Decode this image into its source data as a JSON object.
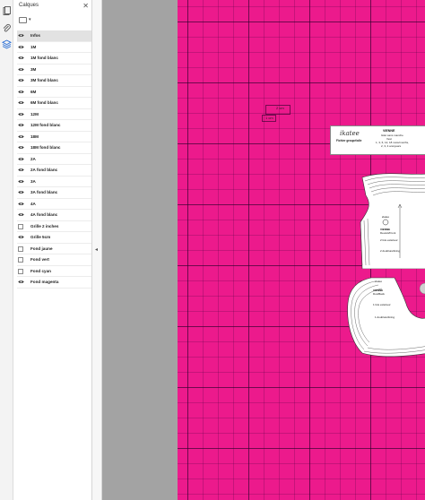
{
  "panel": {
    "title": "Calques",
    "close_label": "✕"
  },
  "layers": [
    {
      "label": "Infos",
      "visible": true,
      "selected": true
    },
    {
      "label": "1M",
      "visible": true
    },
    {
      "label": "1M fond blanc",
      "visible": true
    },
    {
      "label": "3M",
      "visible": true
    },
    {
      "label": "3M fond blanc",
      "visible": true
    },
    {
      "label": "6M",
      "visible": true
    },
    {
      "label": "6M fond blanc",
      "visible": true
    },
    {
      "label": "12M",
      "visible": true
    },
    {
      "label": "12M fond blanc",
      "visible": true
    },
    {
      "label": "18M",
      "visible": true
    },
    {
      "label": "18M fond blanc",
      "visible": true
    },
    {
      "label": "2A",
      "visible": true
    },
    {
      "label": "2A fond blanc",
      "visible": true
    },
    {
      "label": "3A",
      "visible": true
    },
    {
      "label": "3A fond blanc",
      "visible": true
    },
    {
      "label": "4A",
      "visible": true
    },
    {
      "label": "4A fond blanc",
      "visible": true
    },
    {
      "label": "Grille 2 inches",
      "visible": false
    },
    {
      "label": "Grille 5cm",
      "visible": true
    },
    {
      "label": "Fond jaune",
      "visible": false
    },
    {
      "label": "Fond vert",
      "visible": false
    },
    {
      "label": "Fond cyan",
      "visible": false
    },
    {
      "label": "Fond magenta",
      "visible": true
    }
  ],
  "document": {
    "page_color": "#ec1a8c",
    "scale_1": "2 cm",
    "scale_2": "1 cm",
    "title_block": {
      "signature": "ikatee",
      "name": "VIENNE",
      "line1": "Gilet sans manche",
      "line2": "Vest",
      "line3": "1, 3, 6, 12, 18 mois/months,",
      "line4": "2, 3, 4 ans/years",
      "footer": "Fichier groupé/alle"
    },
    "piece1": {
      "brand": "ikatee",
      "name": "VIENNE",
      "note1": "Devant/Front",
      "note2": "2 fois extérieur",
      "note3": "2 doublure/lining"
    },
    "piece2": {
      "brand": "ikatee",
      "name": "VIENNE",
      "note1": "Dos/Back",
      "note2": "1 fois extérieur",
      "note3": "1 doublure/lining"
    }
  }
}
